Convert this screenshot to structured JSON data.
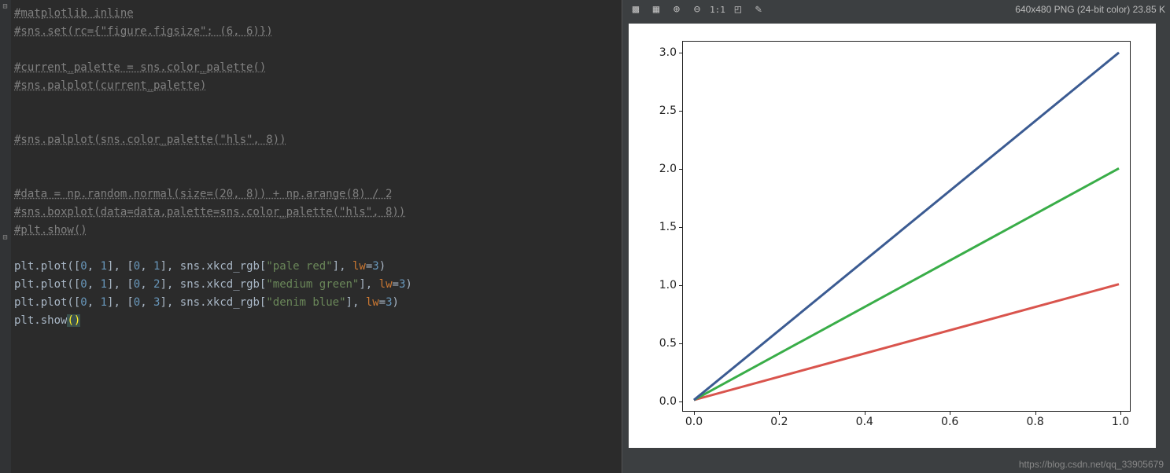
{
  "code_lines": [
    {
      "cls": "comment",
      "text": "#matplotlib inline"
    },
    {
      "cls": "comment",
      "text": "#sns.set(rc={\"figure.figsize\": (6, 6)})"
    },
    {
      "cls": "plain",
      "text": ""
    },
    {
      "cls": "comment",
      "text": "#current_palette = sns.color_palette()"
    },
    {
      "cls": "comment",
      "text": "#sns.palplot(current_palette)"
    },
    {
      "cls": "plain",
      "text": ""
    },
    {
      "cls": "plain",
      "text": ""
    },
    {
      "cls": "comment",
      "text": "#sns.palplot(sns.color_palette(\"hls\", 8))"
    },
    {
      "cls": "plain",
      "text": ""
    },
    {
      "cls": "plain",
      "text": ""
    },
    {
      "cls": "comment",
      "text": "#data = np.random.normal(size=(20, 8)) + np.arange(8) / 2"
    },
    {
      "cls": "comment",
      "text": "#sns.boxplot(data=data,palette=sns.color_palette(\"hls\", 8))"
    },
    {
      "cls": "comment",
      "text": "#plt.show()"
    },
    {
      "cls": "plain",
      "text": ""
    }
  ],
  "plot_lines": [
    {
      "lhs": "plt.plot(",
      "args": "[0, 1], [0, 1]",
      "mid": ", sns.xkcd_rgb[",
      "color_str": "\"pale red\"",
      "tail": "], ",
      "kw": "lw",
      "eq": "=",
      "val": "3",
      "close": ")"
    },
    {
      "lhs": "plt.plot(",
      "args": "[0, 1], [0, 2]",
      "mid": ", sns.xkcd_rgb[",
      "color_str": "\"medium green\"",
      "tail": "], ",
      "kw": "lw",
      "eq": "=",
      "val": "3",
      "close": ")"
    },
    {
      "lhs": "plt.plot(",
      "args": "[0, 1], [0, 3]",
      "mid": ", sns.xkcd_rgb[",
      "color_str": "\"denim blue\"",
      "tail": "], ",
      "kw": "lw",
      "eq": "=",
      "val": "3",
      "close": ")"
    }
  ],
  "final_line": {
    "pre": "plt.show",
    "open": "(",
    "close": ")"
  },
  "viewer": {
    "info": "640x480 PNG (24-bit color) 23.85 K",
    "icons": [
      "checker-icon",
      "grid-icon",
      "zoom-in-icon",
      "zoom-out-icon",
      "one-to-one-icon",
      "box-icon",
      "eyedropper-icon"
    ],
    "one_to_one": "1:1"
  },
  "watermark": "https://blog.csdn.net/qq_33905679",
  "chart_data": {
    "type": "line",
    "x": [
      0.0,
      1.0
    ],
    "series": [
      {
        "name": "pale red",
        "color": "#d9544d",
        "values": [
          0.0,
          1.0
        ]
      },
      {
        "name": "medium green",
        "color": "#39ad48",
        "values": [
          0.0,
          2.0
        ]
      },
      {
        "name": "denim blue",
        "color": "#3b5b92",
        "values": [
          0.0,
          3.0
        ]
      }
    ],
    "xlim": [
      0.0,
      1.0
    ],
    "ylim": [
      0.0,
      3.0
    ],
    "xticks": [
      0.0,
      0.2,
      0.4,
      0.6,
      0.8,
      1.0
    ],
    "yticks": [
      0.0,
      0.5,
      1.0,
      1.5,
      2.0,
      2.5,
      3.0
    ],
    "title": "",
    "xlabel": "",
    "ylabel": ""
  }
}
